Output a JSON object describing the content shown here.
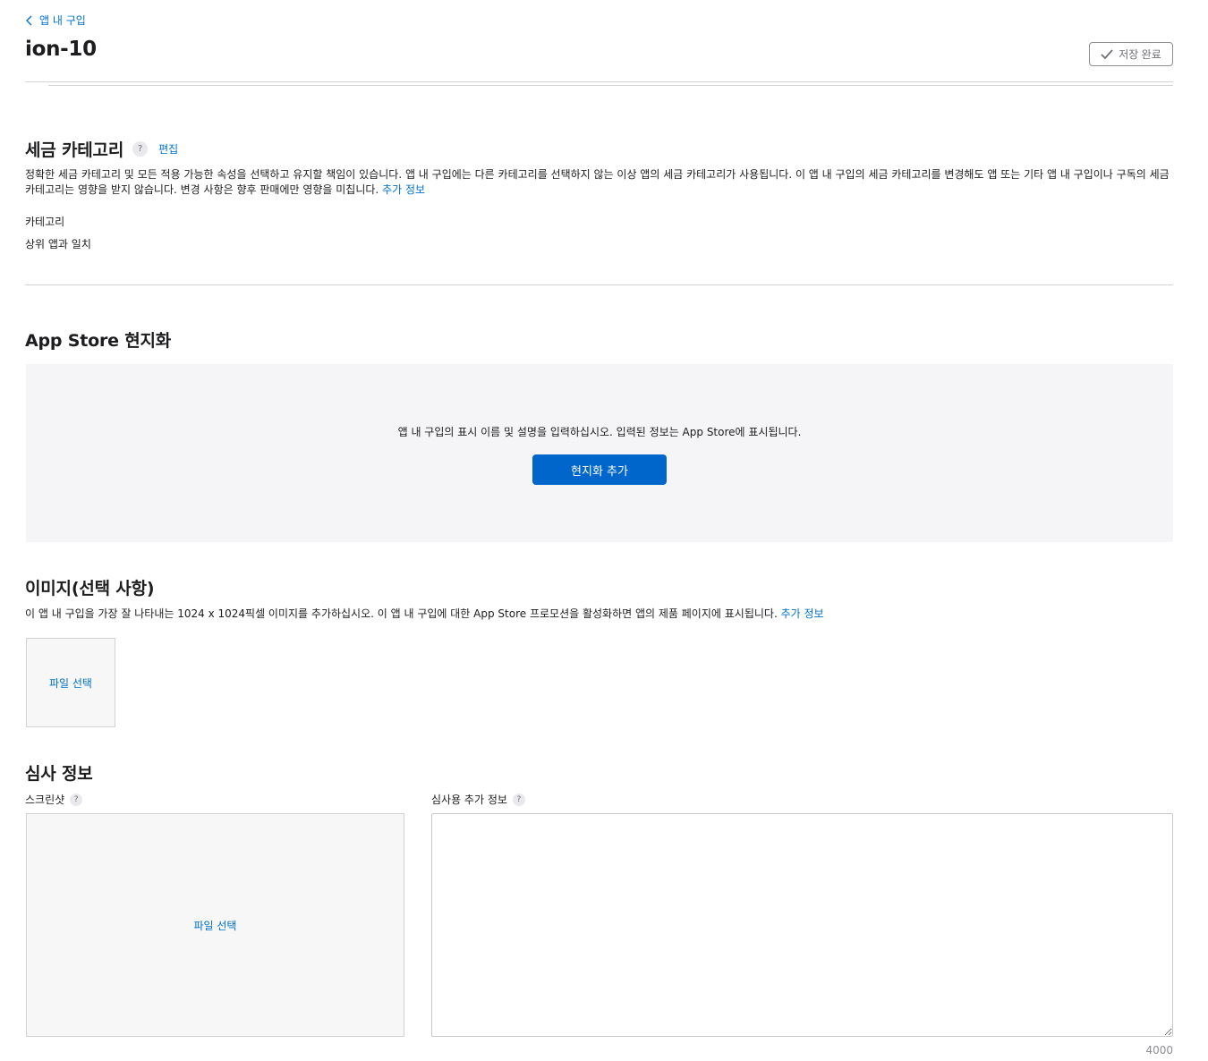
{
  "breadcrumb": {
    "back_label": "앱 내 구입"
  },
  "header": {
    "title": "ion-10",
    "save_label": "저장 완료"
  },
  "tax": {
    "heading": "세금 카테고리",
    "help": "?",
    "edit_label": "편집",
    "description": "정확한 세금 카테고리 및 모든 적용 가능한 속성을 선택하고 유지할 책임이 있습니다. 앱 내 구입에는 다른 카테고리를 선택하지 않는 이상 앱의 세금 카테고리가 사용됩니다. 이 앱 내 구입의 세금 카테고리를 변경해도 앱 또는 기타 앱 내 구입이나 구독의 세금 카테고리는 영향을 받지 않습니다. 변경 사항은 향후 판매에만 영향을 미칩니다.",
    "more_info": "추가 정보",
    "category_label": "카테고리",
    "category_value": "상위 앱과 일치"
  },
  "localization": {
    "heading": "App Store 현지화",
    "description": "앱 내 구입의 표시 이름 및 설명을 입력하십시오. 입력된 정보는 App Store에 표시됩니다.",
    "add_button": "현지화 추가"
  },
  "image": {
    "heading": "이미지(선택 사항)",
    "description": "이 앱 내 구입을 가장 잘 나타내는 1024 x 1024픽셀 이미지를 추가하십시오. 이 앱 내 구입에 대한 App Store 프로모션을 활성화하면 앱의 제품 페이지에 표시됩니다.",
    "more_info": "추가 정보",
    "choose_file": "파일 선택"
  },
  "review": {
    "heading": "심사 정보",
    "screenshot_label": "스크린샷",
    "screenshot_help": "?",
    "choose_file": "파일 선택",
    "notes_label": "심사용 추가 정보",
    "notes_help": "?",
    "notes_value": "",
    "char_limit": "4000"
  }
}
